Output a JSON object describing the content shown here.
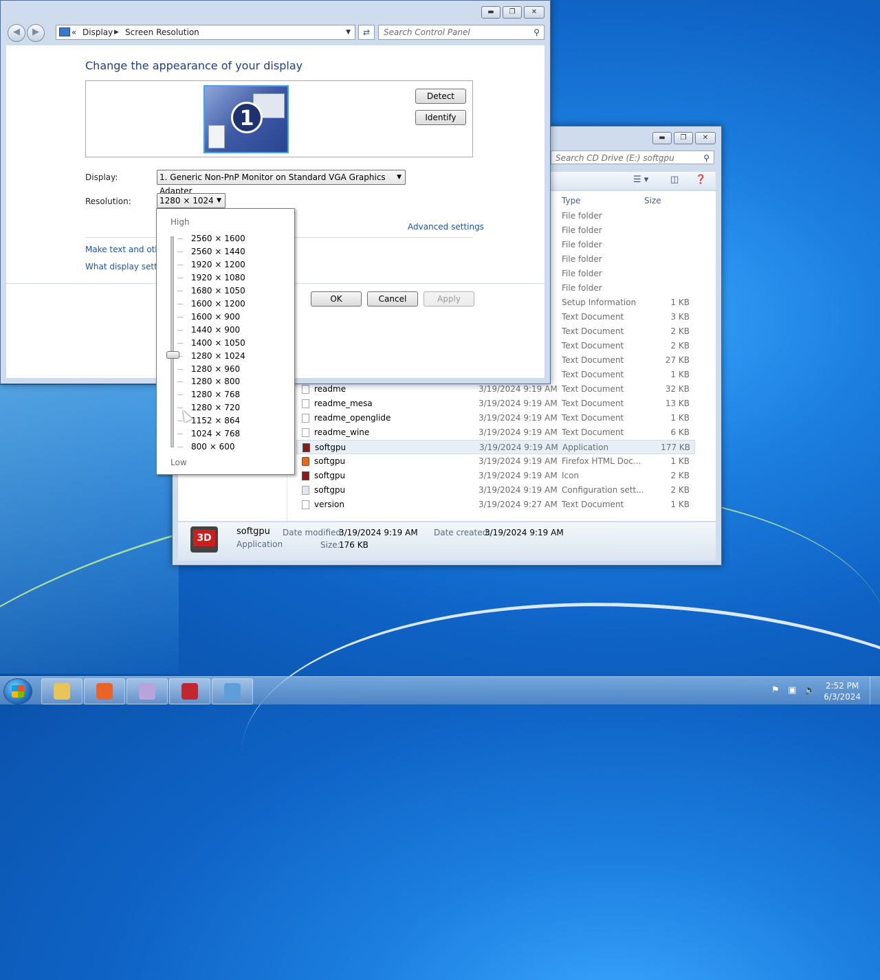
{
  "explorer": {
    "search_placeholder": "Search CD Drive (E:) softgpu",
    "columns": {
      "type": "Type",
      "size": "Size"
    },
    "rows": [
      {
        "name": "",
        "date": "",
        "type": "File folder",
        "size": ""
      },
      {
        "name": "",
        "date": "",
        "type": "File folder",
        "size": ""
      },
      {
        "name": "",
        "date": "",
        "type": "File folder",
        "size": ""
      },
      {
        "name": "",
        "date": "",
        "type": "File folder",
        "size": ""
      },
      {
        "name": "",
        "date": "",
        "type": "File folder",
        "size": ""
      },
      {
        "name": "",
        "date": "",
        "type": "File folder",
        "size": ""
      },
      {
        "name": "",
        "date": "",
        "type": "Setup Information",
        "size": "1 KB"
      },
      {
        "name": "",
        "date": "",
        "type": "Text Document",
        "size": "3 KB"
      },
      {
        "name": "",
        "date": "",
        "type": "Text Document",
        "size": "2 KB"
      },
      {
        "name": "",
        "date": "",
        "type": "Text Document",
        "size": "2 KB"
      },
      {
        "name": "",
        "date": "",
        "type": "Text Document",
        "size": "27 KB"
      },
      {
        "name": "",
        "date": "",
        "type": "Text Document",
        "size": "1 KB"
      },
      {
        "name": "readme",
        "date": "3/19/2024 9:19 AM",
        "type": "Text Document",
        "size": "32 KB"
      },
      {
        "name": "readme_mesa",
        "date": "3/19/2024 9:19 AM",
        "type": "Text Document",
        "size": "13 KB"
      },
      {
        "name": "readme_openglide",
        "date": "3/19/2024 9:19 AM",
        "type": "Text Document",
        "size": "1 KB"
      },
      {
        "name": "readme_wine",
        "date": "3/19/2024 9:19 AM",
        "type": "Text Document",
        "size": "6 KB"
      },
      {
        "name": "softgpu",
        "date": "3/19/2024 9:19 AM",
        "type": "Application",
        "size": "177 KB"
      },
      {
        "name": "softgpu",
        "date": "3/19/2024 9:19 AM",
        "type": "Firefox HTML Doc...",
        "size": "1 KB"
      },
      {
        "name": "softgpu",
        "date": "3/19/2024 9:19 AM",
        "type": "Icon",
        "size": "2 KB"
      },
      {
        "name": "softgpu",
        "date": "3/19/2024 9:19 AM",
        "type": "Configuration sett...",
        "size": "2 KB"
      },
      {
        "name": "version",
        "date": "3/19/2024 9:27 AM",
        "type": "Text Document",
        "size": "1 KB"
      }
    ],
    "details": {
      "name": "softgpu",
      "kind": "Application",
      "modified_label": "Date modified:",
      "modified_value": "3/19/2024 9:19 AM",
      "created_label": "Date created:",
      "created_value": "3/19/2024 9:19 AM",
      "size_label": "Size:",
      "size_value": "176 KB",
      "icon_text": "3D"
    }
  },
  "screen_resolution": {
    "breadcrumb": [
      "Display",
      "Screen Resolution"
    ],
    "breadcrumb_prefix": "«",
    "search_placeholder": "Search Control Panel",
    "title": "Change the appearance of your display",
    "monitor_number": "1",
    "detect_label": "Detect",
    "identify_label": "Identify",
    "display_label": "Display:",
    "display_value": "1. Generic Non-PnP Monitor on Standard VGA Graphics Adapter",
    "resolution_label": "Resolution:",
    "resolution_value": "1280 × 1024",
    "advanced_settings": "Advanced settings",
    "link1": "Make text and other",
    "link2": "What display setting",
    "ok_label": "OK",
    "cancel_label": "Cancel",
    "apply_label": "Apply"
  },
  "resolution_popup": {
    "high_label": "High",
    "low_label": "Low",
    "options": [
      "2560 × 1600",
      "2560 × 1440",
      "1920 × 1200",
      "1920 × 1080",
      "1680 × 1050",
      "1600 × 1200",
      "1600 × 900",
      "1440 × 900",
      "1400 × 1050",
      "1280 × 1024",
      "1280 × 960",
      "1280 × 800",
      "1280 × 768",
      "1280 × 720",
      "1152 × 864",
      "1024 × 768",
      "800 × 600"
    ],
    "selected_index": 9
  },
  "taskbar": {
    "time": "2:52 PM",
    "date": "6/3/2024",
    "apps": [
      "windows-explorer-icon",
      "firefox-icon",
      "media-player-icon",
      "softgpu-icon",
      "control-panel-icon"
    ],
    "app_colors": [
      "#e8c45a",
      "#e8642a",
      "#b8a4d8",
      "#c2262e",
      "#5d9fd8"
    ]
  }
}
